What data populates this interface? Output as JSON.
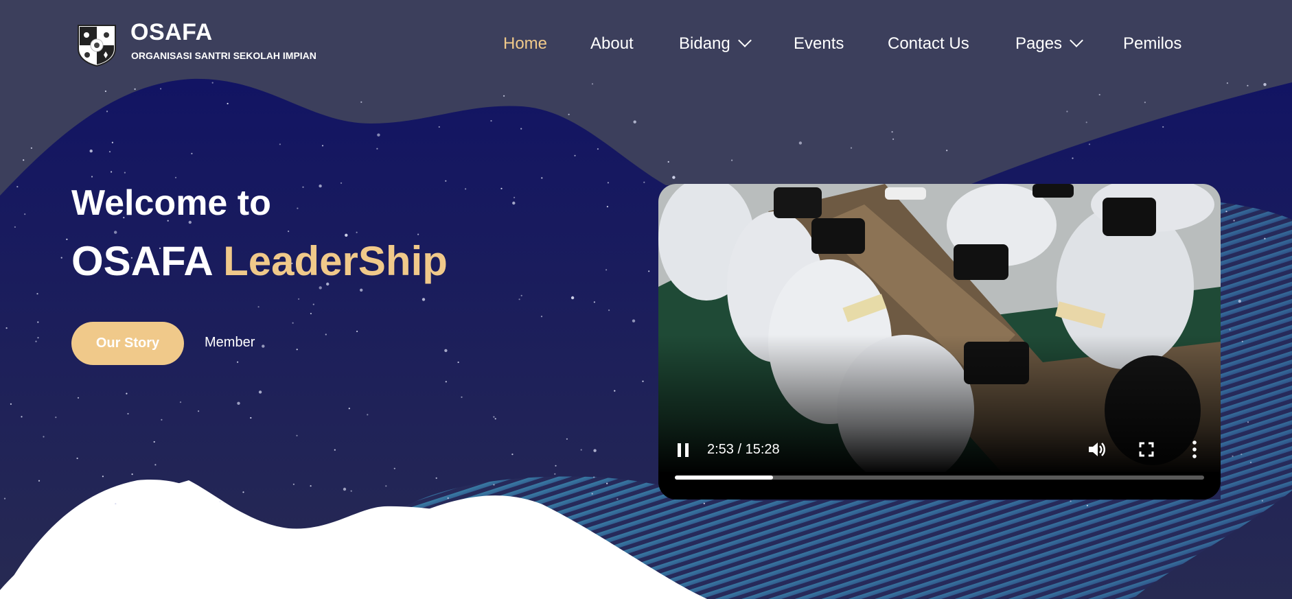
{
  "brand": {
    "title": "OSAFA",
    "subtitle": "ORGANISASI SANTRI SEKOLAH IMPIAN",
    "logo_icon": "shield-crest-icon"
  },
  "nav": {
    "items": [
      {
        "label": "Home",
        "active": true,
        "dropdown": false
      },
      {
        "label": "About",
        "active": false,
        "dropdown": false
      },
      {
        "label": "Bidang",
        "active": false,
        "dropdown": true
      },
      {
        "label": "Events",
        "active": false,
        "dropdown": false
      },
      {
        "label": "Contact Us",
        "active": false,
        "dropdown": false
      },
      {
        "label": "Pages",
        "active": false,
        "dropdown": true
      },
      {
        "label": "Pemilos",
        "active": false,
        "dropdown": false
      }
    ]
  },
  "hero": {
    "line1": "Welcome to",
    "line2_plain": "OSAFA",
    "line2_accent": "LeaderShip",
    "primary_button": "Our Story",
    "secondary_link": "Member"
  },
  "video": {
    "current_time": "2:53",
    "duration": "15:28",
    "time_display": "2:53 / 15:28",
    "progress_fraction": 0.186,
    "playing": true,
    "icons": [
      "pause-icon",
      "volume-icon",
      "fullscreen-icon",
      "more-options-icon"
    ]
  },
  "colors": {
    "header_bg": "#3c3f5c",
    "sky_top": "#121463",
    "sky_bottom": "#262a52",
    "accent": "#f0c98a",
    "wave_stripe": "#2e5a85",
    "white": "#ffffff"
  }
}
